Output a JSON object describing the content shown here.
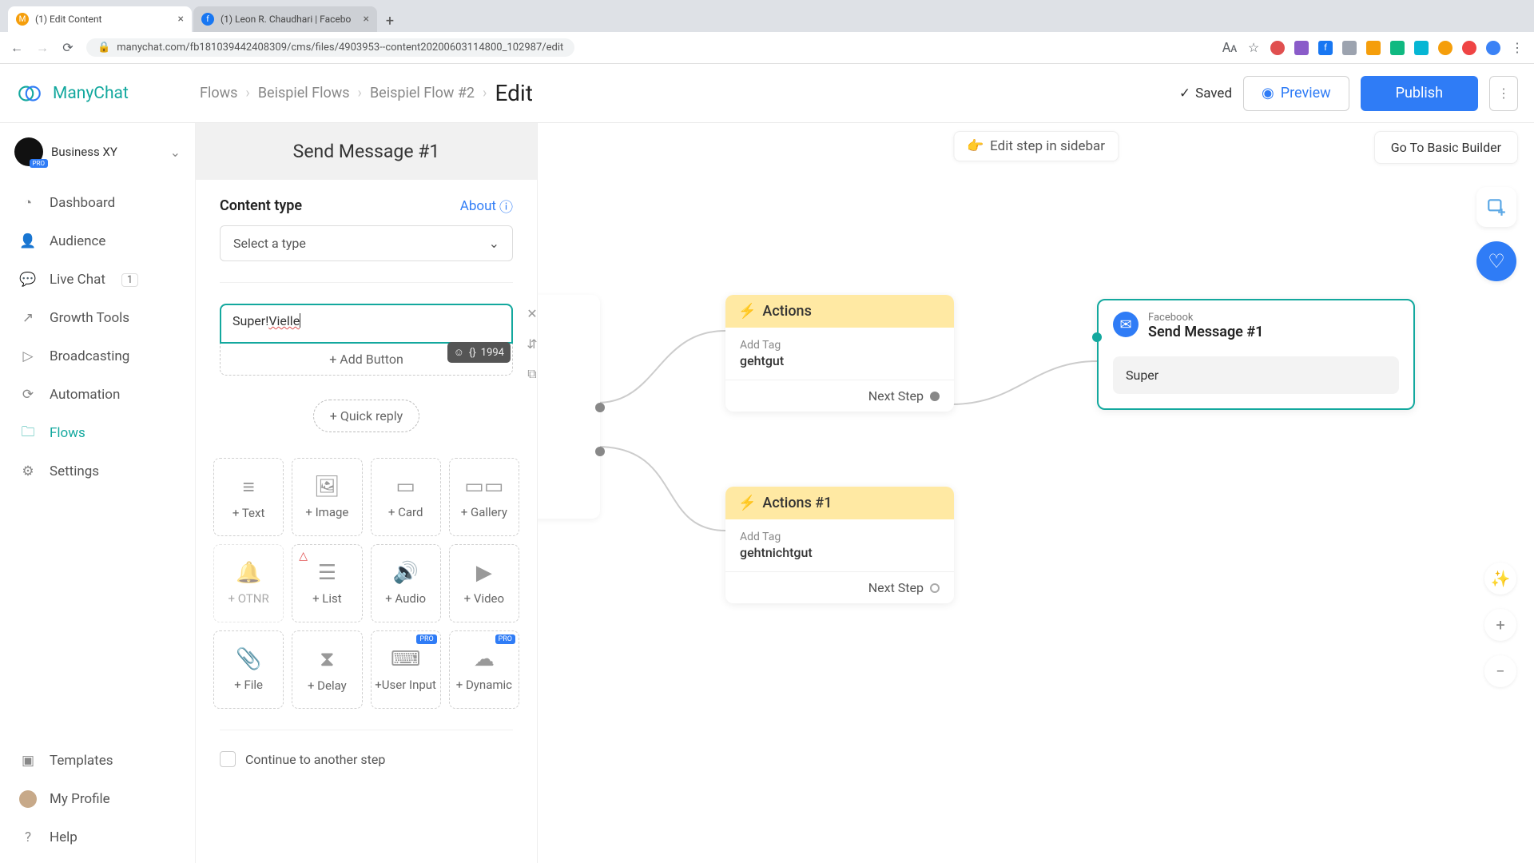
{
  "chrome": {
    "tabs": [
      {
        "title": "(1) Edit Content",
        "active": true
      },
      {
        "title": "(1) Leon R. Chaudhari | Facebo",
        "active": false
      }
    ],
    "url": "manychat.com/fb181039442408309/cms/files/4903953--content20200603114800_102987/edit"
  },
  "brand": "ManyChat",
  "workspace": {
    "name": "Business XY",
    "badge": "PRO"
  },
  "nav": {
    "items": [
      {
        "label": "Dashboard",
        "icon": "◔"
      },
      {
        "label": "Audience",
        "icon": "👤"
      },
      {
        "label": "Live Chat",
        "icon": "💬",
        "badge": "1"
      },
      {
        "label": "Growth Tools",
        "icon": "↗"
      },
      {
        "label": "Broadcasting",
        "icon": "▷"
      },
      {
        "label": "Automation",
        "icon": "⟳"
      },
      {
        "label": "Flows",
        "icon": "🗀",
        "active": true
      },
      {
        "label": "Settings",
        "icon": "⚙"
      }
    ],
    "bottom": [
      {
        "label": "Templates",
        "icon": "▣"
      },
      {
        "label": "My Profile",
        "icon": "avatar"
      },
      {
        "label": "Help",
        "icon": "?"
      }
    ]
  },
  "breadcrumb": [
    "Flows",
    "Beispiel Flows",
    "Beispiel Flow #2",
    "Edit"
  ],
  "header": {
    "saved": "Saved",
    "preview": "Preview",
    "publish": "Publish"
  },
  "canvas": {
    "editInSidebar": "Edit step in sidebar",
    "gotoBasic": "Go To Basic Builder"
  },
  "editor": {
    "title": "Send Message #1",
    "contentTypeLabel": "Content type",
    "about": "About",
    "selectPlaceholder": "Select a type",
    "messageText": "Super! ",
    "messageSpell": "Vielle",
    "addButton": "+ Add Button",
    "charCount": "1994",
    "quickReply": "+ Quick reply",
    "continue": "Continue to another step",
    "blocks": [
      {
        "label": "+ Text",
        "icon": "≡"
      },
      {
        "label": "+ Image",
        "icon": "🖼"
      },
      {
        "label": "+ Card",
        "icon": "▭"
      },
      {
        "label": "+ Gallery",
        "icon": "▭▭"
      },
      {
        "label": "+ OTNR",
        "icon": "🔔",
        "disabled": true
      },
      {
        "label": "+ List",
        "icon": "☰",
        "warn": true
      },
      {
        "label": "+ Audio",
        "icon": "🔊"
      },
      {
        "label": "+ Video",
        "icon": "▶"
      },
      {
        "label": "+ File",
        "icon": "📎"
      },
      {
        "label": "+ Delay",
        "icon": "⧗",
        "pro": false
      },
      {
        "label": "+User Input",
        "icon": "⌨",
        "pro": true
      },
      {
        "label": "+ Dynamic",
        "icon": "☁",
        "pro": true
      }
    ]
  },
  "nodes": {
    "actions": {
      "title": "Actions",
      "k": "Add Tag",
      "v": "gehtgut",
      "next": "Next Step"
    },
    "actions1": {
      "title": "Actions #1",
      "k": "Add Tag",
      "v": "gehtnichtgut",
      "next": "Next Step"
    },
    "send": {
      "platform": "Facebook",
      "title": "Send Message #1",
      "bubble": "Super"
    }
  }
}
